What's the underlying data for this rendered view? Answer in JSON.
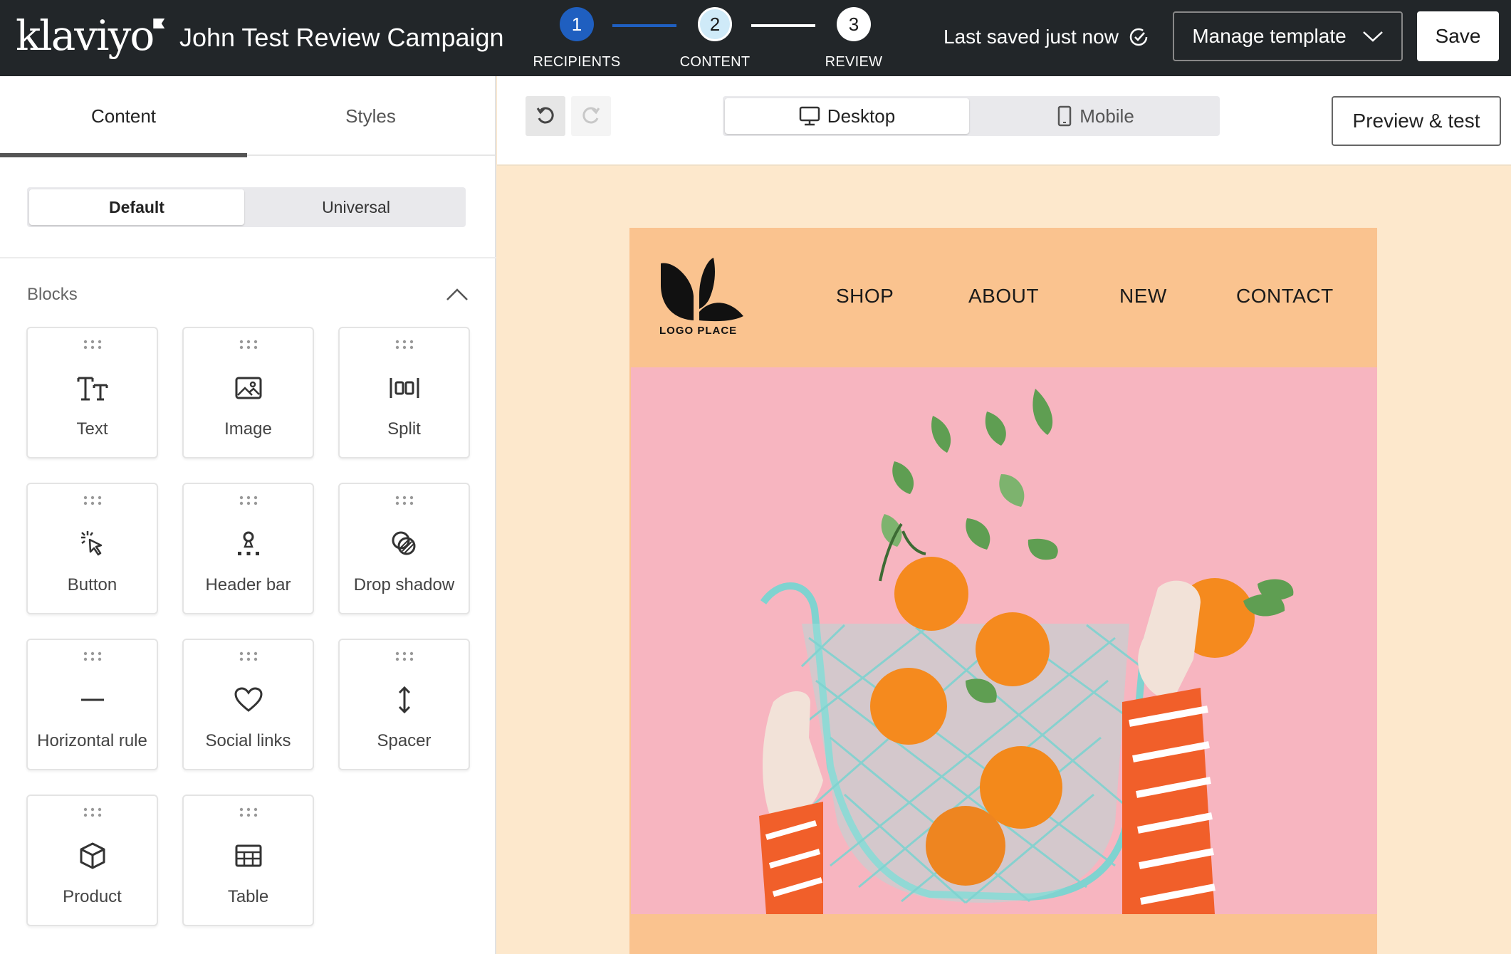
{
  "brand": "klaviyo",
  "campaign_title": "John Test Review Campaign",
  "steps": [
    {
      "num": "1",
      "label": "RECIPIENTS"
    },
    {
      "num": "2",
      "label": "CONTENT"
    },
    {
      "num": "3",
      "label": "REVIEW"
    }
  ],
  "saved_status": "Last saved just now",
  "manage_label": "Manage template",
  "save_label": "Save",
  "left_tabs": {
    "content": "Content",
    "styles": "Styles"
  },
  "block_mode": {
    "default": "Default",
    "universal": "Universal"
  },
  "blocks_heading": "Blocks",
  "blocks": [
    {
      "label": "Text",
      "icon": "text-icon"
    },
    {
      "label": "Image",
      "icon": "image-icon"
    },
    {
      "label": "Split",
      "icon": "split-icon"
    },
    {
      "label": "Button",
      "icon": "cursor-click-icon"
    },
    {
      "label": "Header bar",
      "icon": "header-bar-icon"
    },
    {
      "label": "Drop shadow",
      "icon": "drop-shadow-icon"
    },
    {
      "label": "Horizontal rule",
      "icon": "horizontal-rule-icon"
    },
    {
      "label": "Social links",
      "icon": "heart-icon"
    },
    {
      "label": "Spacer",
      "icon": "vertical-arrows-icon"
    },
    {
      "label": "Product",
      "icon": "cube-icon"
    },
    {
      "label": "Table",
      "icon": "table-icon"
    }
  ],
  "device": {
    "desktop": "Desktop",
    "mobile": "Mobile"
  },
  "preview_label": "Preview & test",
  "email": {
    "logo_text": "LOGO PLACE",
    "nav": [
      "SHOP",
      "ABOUT",
      "NEW",
      "CONTACT"
    ]
  },
  "colors": {
    "topbar": "#222629",
    "step_active": "#1f5fc0",
    "canvas_bg": "#fde8cc",
    "email_header": "#fac38f",
    "hero_bg": "#f7b5c0"
  }
}
